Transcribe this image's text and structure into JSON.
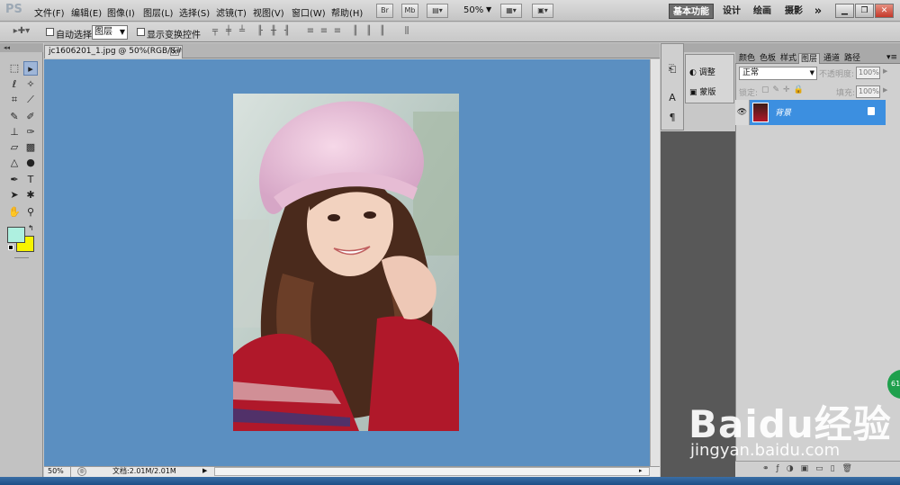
{
  "app": {
    "logo": "PS"
  },
  "menu": [
    "文件(F)",
    "编辑(E)",
    "图像(I)",
    "图层(L)",
    "选择(S)",
    "滤镜(T)",
    "视图(V)",
    "窗口(W)",
    "帮助(H)"
  ],
  "menubar_extras": {
    "zoom": "50%",
    "br": "Br",
    "mb": "Mb"
  },
  "workspaces": {
    "basic": "基本功能",
    "design": "设计",
    "painting": "绘画",
    "photography": "摄影",
    "more": "»"
  },
  "options_bar": {
    "auto_select_label": "自动选择:",
    "auto_select_value": "图层",
    "show_transform_label": "显示变换控件"
  },
  "document": {
    "tab_title": "jc1606201_1.jpg @ 50%(RGB/8#)",
    "tab_close": "×",
    "zoom": "50%",
    "doc_info": "文档:2.01M/2.01M"
  },
  "adjust_panel": {
    "adjustments": "调整",
    "masks": "蒙版"
  },
  "layers_panel": {
    "tabs": [
      "颜色",
      "色板",
      "样式",
      "图层",
      "通道",
      "路径"
    ],
    "active_tab": "图层",
    "blend_mode": "正常",
    "opacity_label": "不透明度:",
    "opacity_value": "100%",
    "lock_label": "锁定:",
    "fill_label": "填充:",
    "fill_value": "100%",
    "layer_name": "背景"
  },
  "watermark": {
    "logo": "Baidu经验",
    "url": "jingyan.baidu.com"
  },
  "badge": {
    "value": "61"
  },
  "colors": {
    "canvas_bg": "#5b8fc1",
    "selected_layer": "#3c8fe0",
    "foreground": "#aef0e0",
    "background": "#f7f400"
  }
}
